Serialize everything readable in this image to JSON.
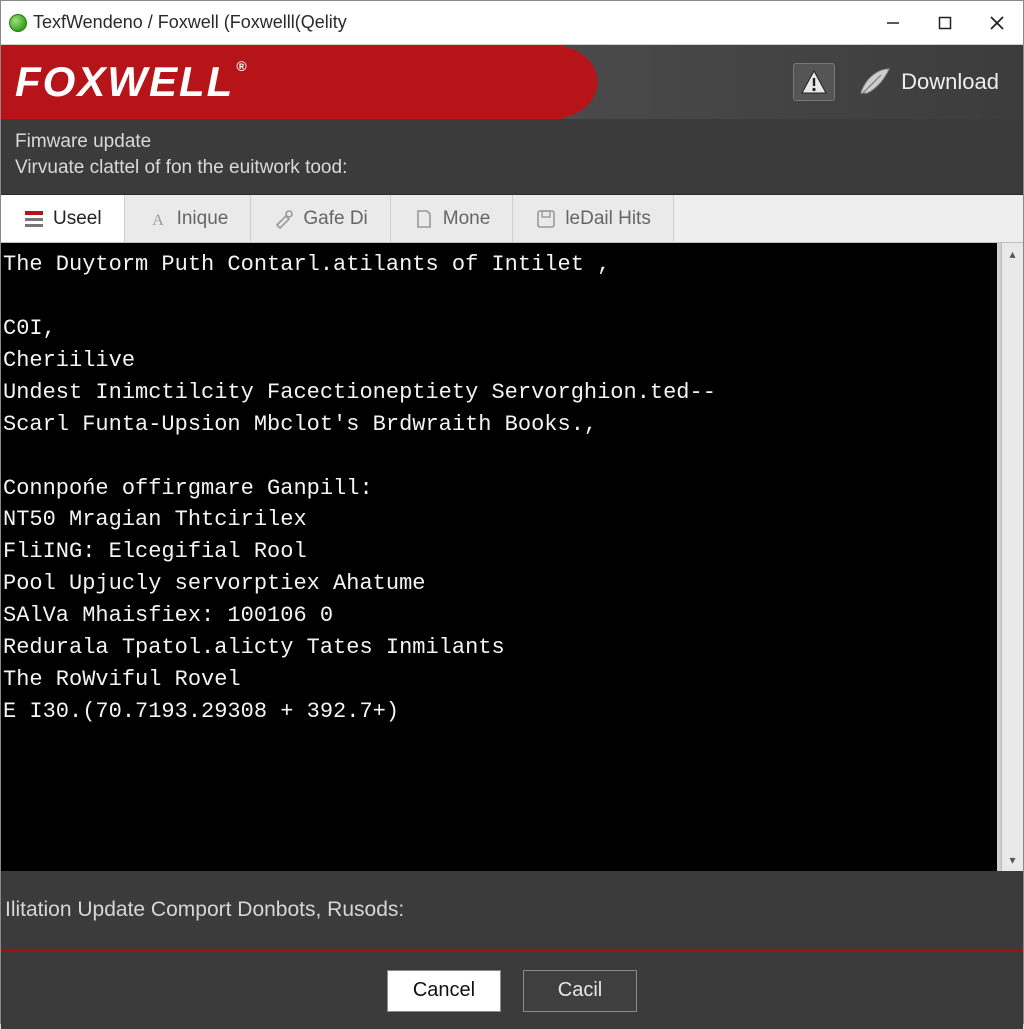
{
  "window": {
    "title": "TexfWendeno / Foxwell (Foxwelll(Qelity"
  },
  "brand": {
    "logo_text": "FOXWELL",
    "reg_mark": "®",
    "download_label": "Download"
  },
  "subdesc": {
    "line1": "Fimware update",
    "line2": "Virvuate clattel of fon the euitwork tood:"
  },
  "tabs": [
    {
      "label": "Useel",
      "active": true
    },
    {
      "label": "Inique",
      "active": false
    },
    {
      "label": "Gafe Di",
      "active": false
    },
    {
      "label": "Mone",
      "active": false
    },
    {
      "label": "leDail Hits",
      "active": false
    }
  ],
  "console": {
    "lines": [
      "The Duytorm Puth Contarl.atilants of Intilet ,",
      "",
      "C0I,",
      "Cheriilive",
      "Undest Inimctilcity Facectioneptiety Servorghion.ted--",
      "Scarl Funta-Upsion Mbclot's Brdwraith Books.,",
      "",
      "Connpоńe offirgmare Ganpill:",
      "NT50 Mragian Thtcirilex",
      "FliING: Elcegifial Rool",
      "Pool Upjucly servorptiex Ahatume",
      "SAlVa Mhaisfiex: 100106 0",
      "Redurala Tpatol.alicty Tates Inmilants",
      "The RoWviful Rovel",
      "E I30.(70.7193.29308 + 392.7+)"
    ]
  },
  "status": {
    "text": "Ilitation Update Comport Donbots, Rusods:"
  },
  "footer": {
    "cancel_label": "Cancel",
    "secondary_label": "Cacil"
  }
}
